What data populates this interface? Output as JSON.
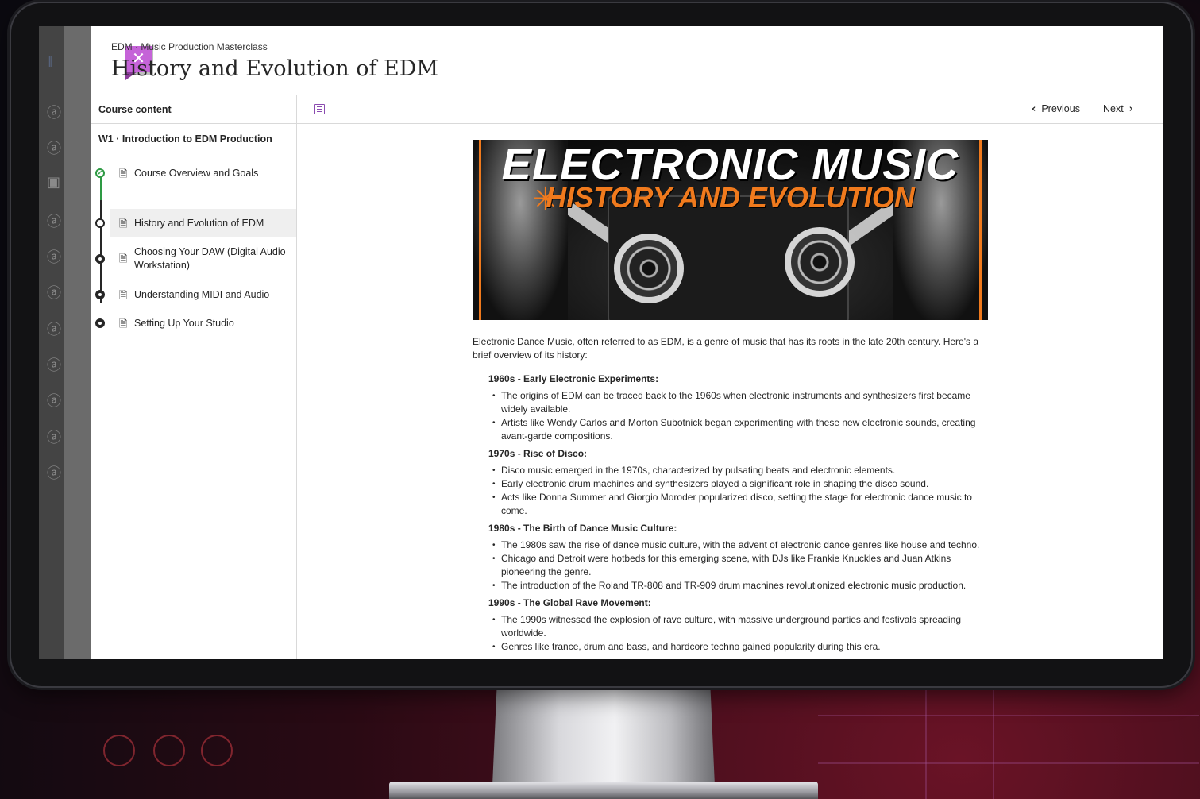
{
  "header": {
    "breadcrumb": "EDM · Music Production Masterclass",
    "title": "History and Evolution of EDM",
    "close_icon": "close-icon"
  },
  "sidebar": {
    "heading": "Course content",
    "week": "W1 · Introduction to EDM Production",
    "lessons": [
      {
        "label": "Course Overview and Goals",
        "status": "completed"
      },
      {
        "label": "History and Evolution of EDM",
        "status": "current"
      },
      {
        "label": "Choosing Your DAW (Digital Audio Workstation)",
        "status": "locked"
      },
      {
        "label": "Understanding MIDI and Audio",
        "status": "locked"
      },
      {
        "label": "Setting Up Your Studio",
        "status": "locked"
      }
    ]
  },
  "toolbar": {
    "previous": "Previous",
    "next": "Next"
  },
  "hero": {
    "line1": "ELECTRONIC MUSIC",
    "line2": "HISTORY AND EVOLUTION",
    "accent": "#f07a1d"
  },
  "article": {
    "intro": "Electronic Dance Music, often referred to as EDM, is a genre of music that has its roots in the late 20th century. Here's a brief overview of its history:",
    "eras": [
      {
        "heading": "1960s - Early Electronic Experiments:",
        "points": [
          "The origins of EDM can be traced back to the 1960s when electronic instruments and synthesizers first became widely available.",
          "Artists like Wendy Carlos and Morton Subotnick began experimenting with these new electronic sounds, creating avant-garde compositions."
        ]
      },
      {
        "heading": "1970s - Rise of Disco:",
        "points": [
          "Disco music emerged in the 1970s, characterized by pulsating beats and electronic elements.",
          "Early electronic drum machines and synthesizers played a significant role in shaping the disco sound.",
          "Acts like Donna Summer and Giorgio Moroder popularized disco, setting the stage for electronic dance music to come."
        ]
      },
      {
        "heading": "1980s - The Birth of Dance Music Culture:",
        "points": [
          "The 1980s saw the rise of dance music culture, with the advent of electronic dance genres like house and techno.",
          "Chicago and Detroit were hotbeds for this emerging scene, with DJs like Frankie Knuckles and Juan Atkins pioneering the genre.",
          "The introduction of the Roland TR-808 and TR-909 drum machines revolutionized electronic music production."
        ]
      },
      {
        "heading": "1990s - The Global Rave Movement:",
        "points": [
          "The 1990s witnessed the explosion of rave culture, with massive underground parties and festivals spreading worldwide.",
          "Genres like trance, drum and bass, and hardcore techno gained popularity during this era."
        ]
      }
    ]
  },
  "colors": {
    "brand": "#c563d8",
    "completed": "#2e9a44",
    "outline_icon": "#8b4bb0"
  }
}
